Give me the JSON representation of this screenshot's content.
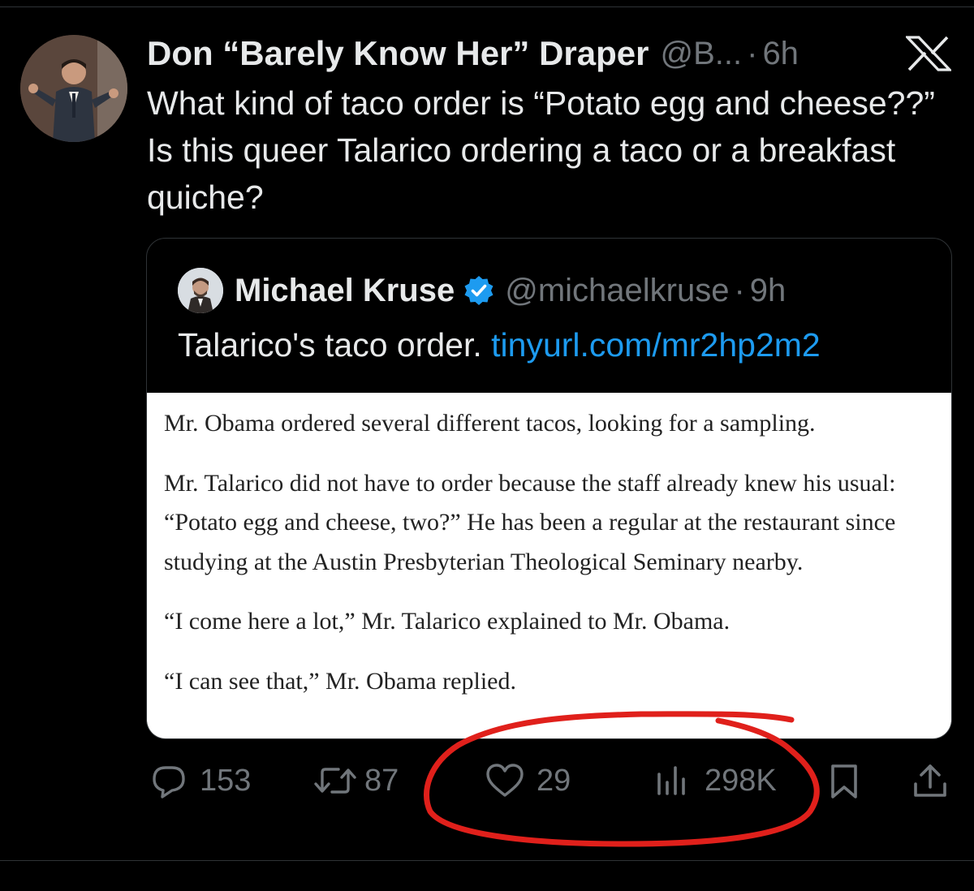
{
  "tweet": {
    "author": {
      "display_name": "Don “Barely Know Her” Draper",
      "handle": "@B...",
      "time": "6h"
    },
    "text": "What kind of taco order is “Potato egg and cheese??” Is this queer Talarico ordering a taco or a breakfast quiche?",
    "quote": {
      "author": {
        "display_name": "Michael Kruse",
        "handle": "@michaelkruse",
        "time": "9h"
      },
      "text": "Talarico's taco order.",
      "link": "tinyurl.com/mr2hp2m2",
      "image_paragraphs": [
        "Mr. Obama ordered several different tacos, looking for a sampling.",
        "Mr. Talarico did not have to order because the staff already knew his usual: “Potato egg and cheese, two?” He has been a regular at the restaurant since studying at the Austin Presbyterian Theological Seminary nearby.",
        "“I come here a lot,” Mr. Talarico explained to Mr. Obama.",
        "“I can see that,” Mr. Obama replied."
      ]
    },
    "actions": {
      "replies": "153",
      "reposts": "87",
      "likes": "29",
      "views": "298K"
    }
  },
  "colors": {
    "background": "#000000",
    "text": "#e7e9ea",
    "secondary_text": "#71767b",
    "link": "#1d9bf0",
    "verified": "#1d9bf0",
    "annotation_circle": "#e0201b"
  },
  "icons": {
    "logo": "x-logo-icon",
    "reply": "reply-icon",
    "repost": "repost-icon",
    "like": "heart-icon",
    "views": "views-icon",
    "bookmark": "bookmark-icon",
    "share": "share-icon"
  }
}
